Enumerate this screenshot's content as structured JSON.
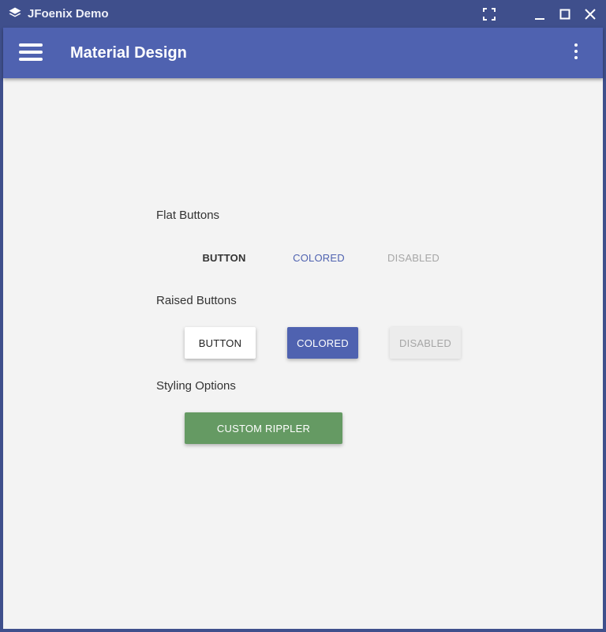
{
  "window": {
    "title": "JFoenix Demo",
    "icons": [
      "layers-icon",
      "fullscreen-icon",
      "minimize-icon",
      "maximize-icon",
      "close-icon"
    ]
  },
  "appbar": {
    "title": "Material Design",
    "menu_icon": "hamburger-menu-icon",
    "options_icon": "more-vertical-icon",
    "color": "#4f62b0"
  },
  "sections": {
    "flat": {
      "label": "Flat Buttons",
      "buttons": [
        "BUTTON",
        "COLORED",
        "DISABLED"
      ]
    },
    "raised": {
      "label": "Raised Buttons",
      "buttons": [
        "BUTTON",
        "COLORED",
        "DISABLED"
      ]
    },
    "styling": {
      "label": "Styling Options",
      "custom_button": "CUSTOM RIPPLER"
    }
  },
  "colors": {
    "accent": "#4f62b0",
    "custom_rippler": "#659a63",
    "disabled_text": "#a6a6a6",
    "background": "#f3f3f3"
  }
}
